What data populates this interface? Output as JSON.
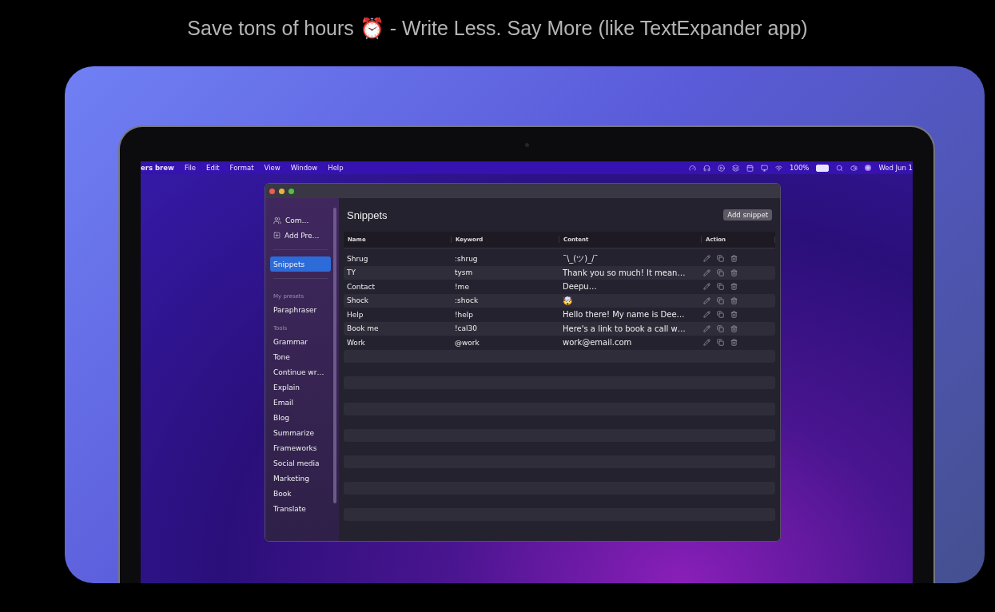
{
  "headline": "Save tons of hours ⏰ - Write Less. Say More (like TextExpander app)",
  "menu_bar": {
    "app_name": "ers brew",
    "menus": [
      "File",
      "Edit",
      "Format",
      "View",
      "Window",
      "Help"
    ],
    "battery": "100%",
    "clock": "Wed Jun 1"
  },
  "sidebar": {
    "top_items": [
      {
        "label": "Com…",
        "kind": "people"
      },
      {
        "label": "Add Pre…",
        "kind": "plus"
      }
    ],
    "items": [
      {
        "label": "Snippets",
        "selected": true
      }
    ],
    "sections": [
      {
        "title": "My presets",
        "items": [
          {
            "label": "Paraphraser",
            "selected": false
          }
        ]
      },
      {
        "title": "Tools",
        "items": [
          {
            "label": "Grammar",
            "selected": false
          },
          {
            "label": "Tone",
            "selected": false
          },
          {
            "label": "Continue wr…",
            "selected": false
          },
          {
            "label": "Explain",
            "selected": false
          },
          {
            "label": "Email",
            "selected": false
          },
          {
            "label": "Blog",
            "selected": false
          },
          {
            "label": "Summarize",
            "selected": false
          },
          {
            "label": "Frameworks",
            "selected": false
          },
          {
            "label": "Social media",
            "selected": false
          },
          {
            "label": "Marketing",
            "selected": false
          },
          {
            "label": "Book",
            "selected": false
          },
          {
            "label": "Translate",
            "selected": false
          }
        ]
      }
    ]
  },
  "main": {
    "title": "Snippets",
    "add_button": "Add snippet"
  },
  "table": {
    "columns": [
      "Name",
      "Keyword",
      "Content",
      "Action"
    ],
    "rows": [
      {
        "name": "Shrug",
        "keyword": ":shrug",
        "content": "¯\\_(ツ)_/¯"
      },
      {
        "name": "TY",
        "keyword": "tysm",
        "content": "Thank you so much! It mean…"
      },
      {
        "name": "Contact",
        "keyword": "!me",
        "content": "Deepu…"
      },
      {
        "name": "Shock",
        "keyword": ":shock",
        "content": "🤯"
      },
      {
        "name": "Help",
        "keyword": "!help",
        "content": "Hello there! My name is Dee…"
      },
      {
        "name": "Book me",
        "keyword": "!cal30",
        "content": "Here's a link to book a call w…"
      },
      {
        "name": "Work",
        "keyword": "@work",
        "content": "work@email.com"
      }
    ]
  }
}
